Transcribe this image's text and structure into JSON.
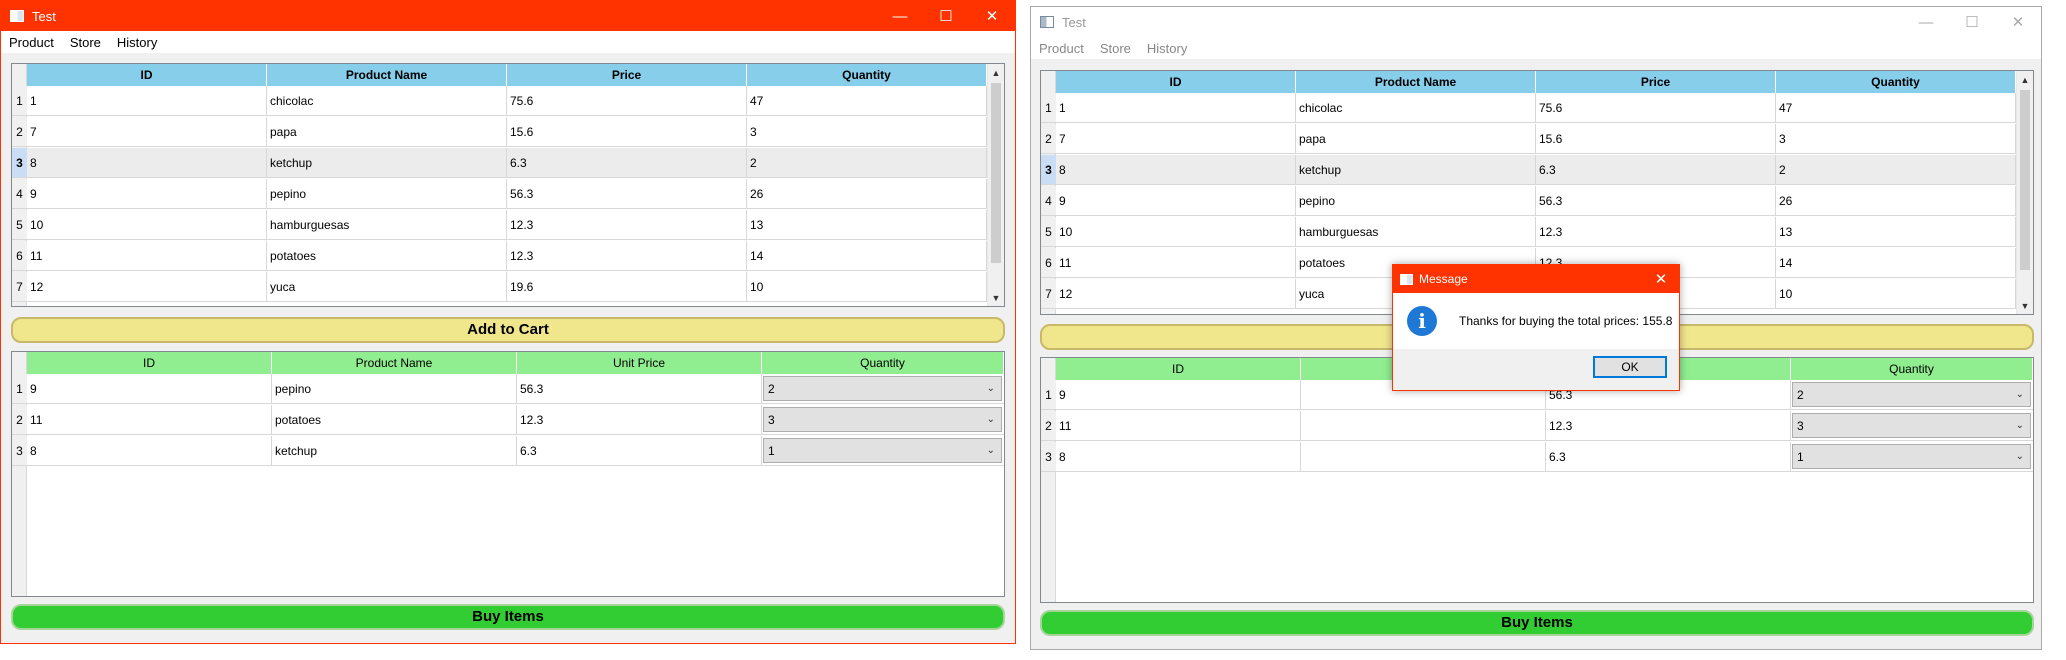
{
  "window": {
    "title": "Test",
    "minimize": "—",
    "maximize": "☐",
    "close": "✕"
  },
  "menu": [
    "Product",
    "Store",
    "History"
  ],
  "products_table": {
    "headers": [
      "ID",
      "Product Name",
      "Price",
      "Quantity"
    ],
    "rows": [
      {
        "n": "1",
        "id": "1",
        "name": "chicolac",
        "price": "75.6",
        "qty": "47"
      },
      {
        "n": "2",
        "id": "7",
        "name": "papa",
        "price": "15.6",
        "qty": "3"
      },
      {
        "n": "3",
        "id": "8",
        "name": "ketchup",
        "price": "6.3",
        "qty": "2"
      },
      {
        "n": "4",
        "id": "9",
        "name": "pepino",
        "price": "56.3",
        "qty": "26"
      },
      {
        "n": "5",
        "id": "10",
        "name": "hamburguesas",
        "price": "12.3",
        "qty": "13"
      },
      {
        "n": "6",
        "id": "11",
        "name": "potatoes",
        "price": "12.3",
        "qty": "14"
      },
      {
        "n": "7",
        "id": "12",
        "name": "yuca",
        "price": "19.6",
        "qty": "10"
      }
    ],
    "selected_row": "3"
  },
  "add_to_cart_label": "Add to Cart",
  "cart_table": {
    "headers": [
      "ID",
      "Product Name",
      "Unit Price",
      "Quantity"
    ],
    "rows": [
      {
        "n": "1",
        "id": "9",
        "name": "pepino",
        "price": "56.3",
        "qty": "2"
      },
      {
        "n": "2",
        "id": "11",
        "name": "potatoes",
        "price": "12.3",
        "qty": "3"
      },
      {
        "n": "3",
        "id": "8",
        "name": "ketchup",
        "price": "6.3",
        "qty": "1"
      }
    ],
    "headers_second_window": [
      "ID",
      "Pro",
      "ce",
      "Quantity"
    ],
    "rows_second_window": [
      {
        "n": "1",
        "id": "9",
        "name": "",
        "price": "56.3",
        "qty": "2"
      },
      {
        "n": "2",
        "id": "11",
        "name": "",
        "price": "12.3",
        "qty": "3"
      },
      {
        "n": "3",
        "id": "8",
        "name": "",
        "price": "6.3",
        "qty": "1"
      }
    ]
  },
  "buy_items_label": "Buy Items",
  "second_window_rows": {
    "products_visible_name_col_under_dialog": [
      "chicolac",
      "papa",
      "ketchup",
      "pepino",
      "hamburguesas",
      "potatoes",
      "yuca"
    ],
    "prices_visible": [
      "75.6",
      "15.6",
      "6.3",
      "56.3",
      "12.3",
      "12.3",
      ""
    ],
    "qty_visible": [
      "47",
      "3",
      "2",
      "26",
      "13",
      "14",
      "10"
    ]
  },
  "dialog": {
    "title": "Message",
    "close": "✕",
    "icon_glyph": "i",
    "message": "Thanks for buying the total prices: 155.8",
    "ok_label": "OK"
  },
  "colors": {
    "active_titlebar": "#ff3300",
    "product_header": "#87ceeb",
    "cart_header": "#90ee90",
    "add_to_cart": "#f0e68c",
    "buy_items": "#32cd32"
  },
  "icons": {
    "scroll_up": "▲",
    "scroll_down": "▼",
    "combo_chevron": "⌄"
  }
}
